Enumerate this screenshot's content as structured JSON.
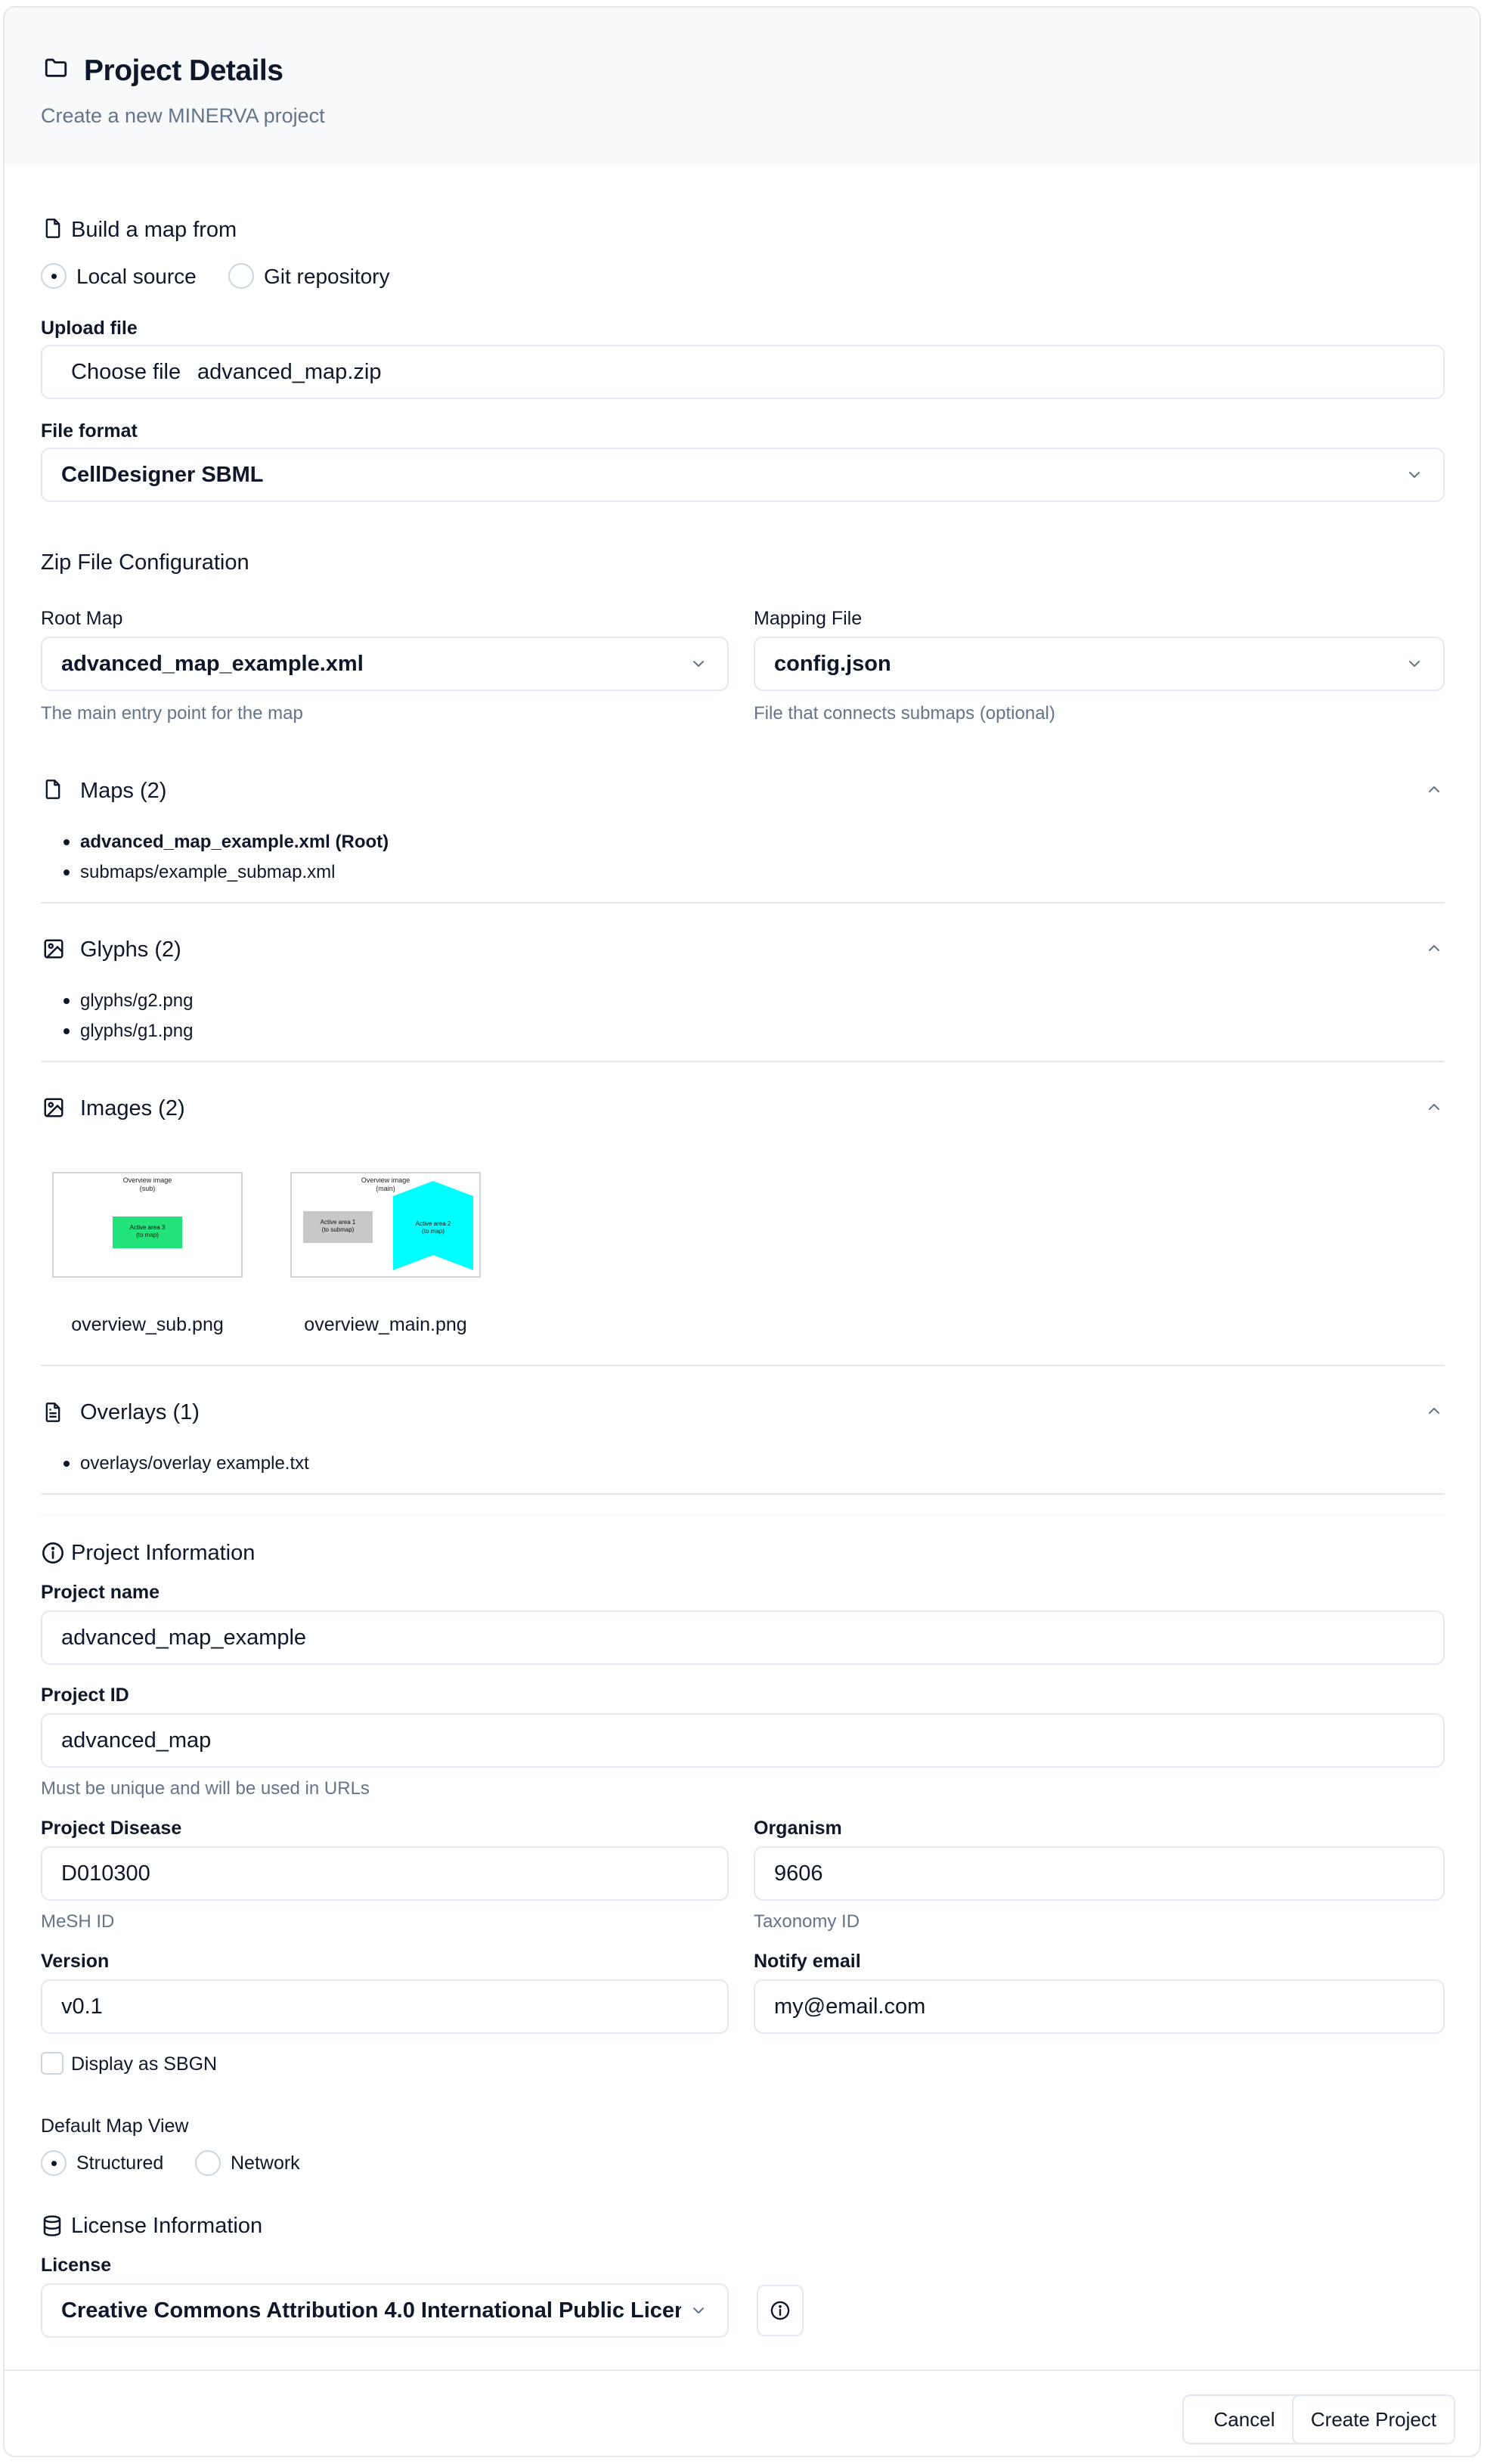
{
  "header": {
    "title": "Project Details",
    "subtitle": "Create a new MINERVA project",
    "icon": "folder-icon"
  },
  "source": {
    "title": "Build a map from",
    "options": [
      {
        "label": "Local source",
        "selected": true
      },
      {
        "label": "Git repository",
        "selected": false
      }
    ]
  },
  "upload": {
    "label": "Upload file",
    "button_label": "Choose file",
    "file_name": "advanced_map.zip"
  },
  "file_format": {
    "label": "File format",
    "value": "CellDesigner SBML"
  },
  "zip_config": {
    "title": "Zip File Configuration",
    "root_map": {
      "label": "Root Map",
      "value": "advanced_map_example.xml",
      "hint": "The main entry point for the map"
    },
    "mapping_file": {
      "label": "Mapping File",
      "value": "config.json",
      "hint": "File that connects submaps (optional)"
    }
  },
  "maps": {
    "title": "Maps (2)",
    "items": [
      "advanced_map_example.xml (Root)",
      "submaps/example_submap.xml"
    ]
  },
  "glyphs": {
    "title": "Glyphs (2)",
    "items": [
      "glyphs/g2.png",
      "glyphs/g1.png"
    ]
  },
  "images": {
    "title": "Images (2)",
    "items": [
      {
        "name": "overview_sub.png",
        "thumb_title": "Overview image",
        "thumb_subtitle": "(sub)",
        "area_label": "Active area 3",
        "area_sub": "(to map)",
        "area_color": "#22e27a"
      },
      {
        "name": "overview_main.png",
        "thumb_title": "Overview image",
        "thumb_subtitle": "(main)",
        "area1_label": "Active area 1",
        "area1_sub": "(to submap)",
        "area2_label": "Active area 2",
        "area2_sub": "(to map)",
        "area1_color": "#c8c8c8",
        "area2_color": "#00ffff"
      }
    ]
  },
  "overlays": {
    "title": "Overlays (1)",
    "items": [
      "overlays/overlay example.txt"
    ]
  },
  "project_info": {
    "title": "Project Information",
    "name": {
      "label": "Project name",
      "value": "advanced_map_example"
    },
    "id": {
      "label": "Project ID",
      "value": "advanced_map",
      "hint": "Must be unique and will be used in URLs"
    },
    "disease": {
      "label": "Project Disease",
      "value": "D010300",
      "hint": "MeSH ID"
    },
    "organism": {
      "label": "Organism",
      "value": "9606",
      "hint": "Taxonomy ID"
    },
    "version": {
      "label": "Version",
      "value": "v0.1"
    },
    "email": {
      "label": "Notify email",
      "value": "my@email.com"
    },
    "sbgn": {
      "label": "Display as SBGN",
      "checked": false
    }
  },
  "map_view": {
    "label": "Default Map View",
    "options": [
      {
        "label": "Structured",
        "selected": true
      },
      {
        "label": "Network",
        "selected": false
      }
    ]
  },
  "license": {
    "title": "License Information",
    "label": "License",
    "value": "Creative Commons Attribution 4.0 International Public Licen"
  },
  "footer": {
    "cancel_label": "Cancel",
    "create_label": "Create Project"
  },
  "colors": {
    "text": "#0f172a",
    "muted": "#64748b",
    "border": "#e2e8f0",
    "header_bg": "#f8fafc"
  }
}
